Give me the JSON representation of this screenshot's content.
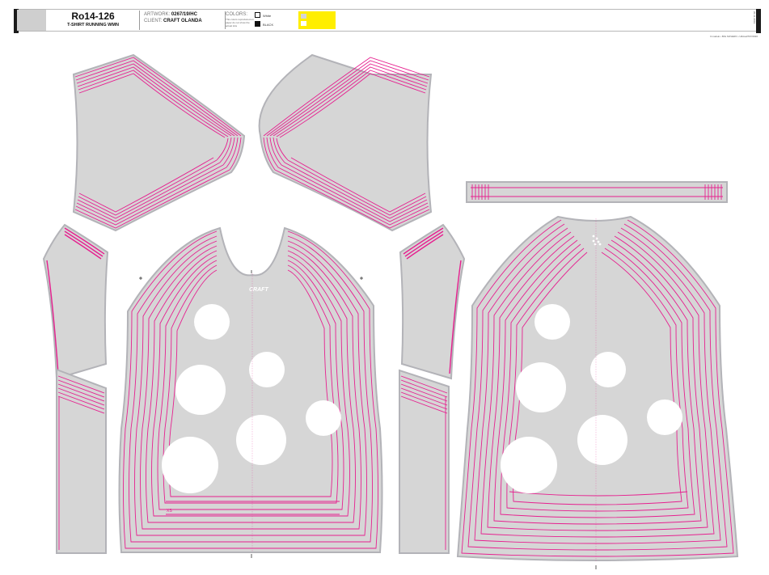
{
  "header": {
    "code": "Ro14-126",
    "product": "T-SHIRT RUNNING WMN",
    "artwork_label": "ARTWORK:",
    "artwork_value": "0267/19/HC",
    "client_label": "CLIENT:",
    "client_value": "CRAFT OLANDA",
    "colors_label": "COLORS:",
    "colors_note": "This colors reproduced on paper do not show the actual inks",
    "swatches": [
      {
        "name": "White",
        "hex": "#ffffff"
      },
      {
        "name": "BLACK",
        "hex": "#111111"
      }
    ],
    "side_code": "20-11-2019",
    "note": "Il modulo • BIG SOVERO • Ultimati?07/2020"
  },
  "pattern": {
    "fabric_color": "#d6d6d6",
    "stripe_color": "#e6208f",
    "edge_color": "#b3b3b8",
    "dot_color": "#ffffff",
    "brand_text": "CRAFT",
    "size_label": "XS"
  }
}
